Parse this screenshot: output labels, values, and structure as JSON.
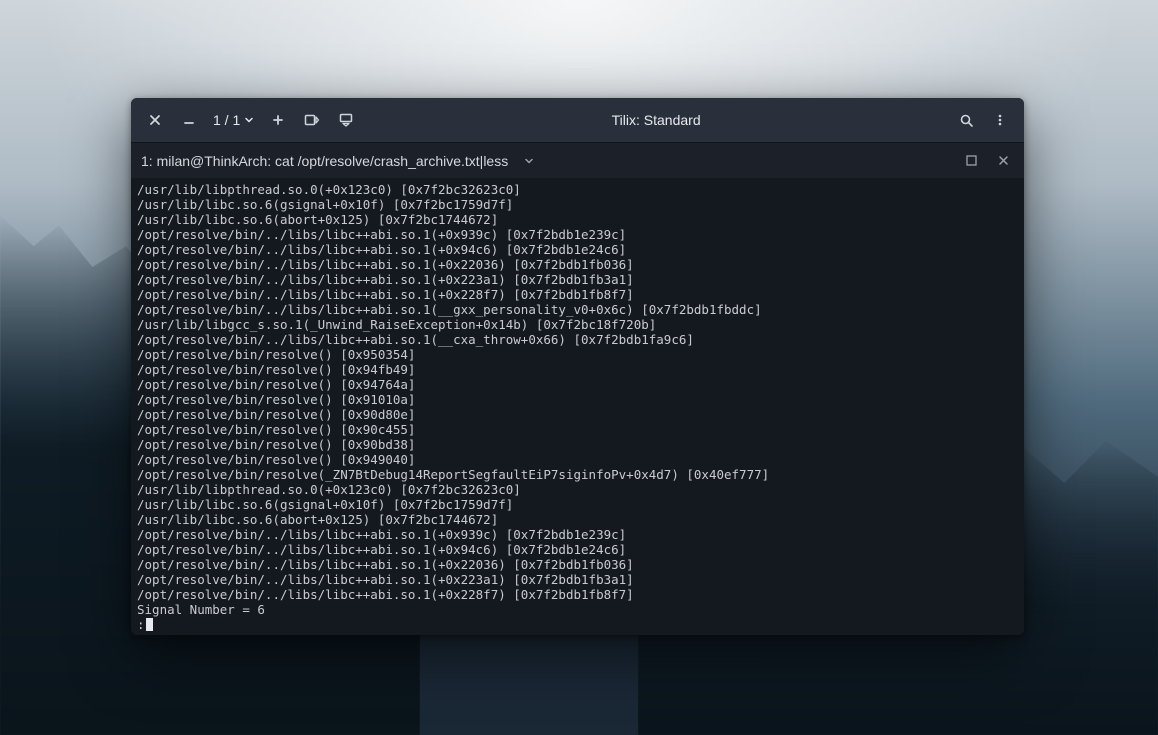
{
  "window": {
    "title": "Tilix: Standard",
    "session_counter": "1 / 1"
  },
  "tab": {
    "title": "1: milan@ThinkArch: cat /opt/resolve/crash_archive.txt|less"
  },
  "terminal": {
    "lines": [
      "/usr/lib/libpthread.so.0(+0x123c0) [0x7f2bc32623c0]",
      "/usr/lib/libc.so.6(gsignal+0x10f) [0x7f2bc1759d7f]",
      "/usr/lib/libc.so.6(abort+0x125) [0x7f2bc1744672]",
      "/opt/resolve/bin/../libs/libc++abi.so.1(+0x939c) [0x7f2bdb1e239c]",
      "/opt/resolve/bin/../libs/libc++abi.so.1(+0x94c6) [0x7f2bdb1e24c6]",
      "/opt/resolve/bin/../libs/libc++abi.so.1(+0x22036) [0x7f2bdb1fb036]",
      "/opt/resolve/bin/../libs/libc++abi.so.1(+0x223a1) [0x7f2bdb1fb3a1]",
      "/opt/resolve/bin/../libs/libc++abi.so.1(+0x228f7) [0x7f2bdb1fb8f7]",
      "/opt/resolve/bin/../libs/libc++abi.so.1(__gxx_personality_v0+0x6c) [0x7f2bdb1fbddc]",
      "/usr/lib/libgcc_s.so.1(_Unwind_RaiseException+0x14b) [0x7f2bc18f720b]",
      "/opt/resolve/bin/../libs/libc++abi.so.1(__cxa_throw+0x66) [0x7f2bdb1fa9c6]",
      "/opt/resolve/bin/resolve() [0x950354]",
      "/opt/resolve/bin/resolve() [0x94fb49]",
      "/opt/resolve/bin/resolve() [0x94764a]",
      "/opt/resolve/bin/resolve() [0x91010a]",
      "/opt/resolve/bin/resolve() [0x90d80e]",
      "/opt/resolve/bin/resolve() [0x90c455]",
      "/opt/resolve/bin/resolve() [0x90bd38]",
      "/opt/resolve/bin/resolve() [0x949040]",
      "/opt/resolve/bin/resolve(_ZN7BtDebug14ReportSegfaultEiP7siginfoPv+0x4d7) [0x40ef777]",
      "/usr/lib/libpthread.so.0(+0x123c0) [0x7f2bc32623c0]",
      "/usr/lib/libc.so.6(gsignal+0x10f) [0x7f2bc1759d7f]",
      "/usr/lib/libc.so.6(abort+0x125) [0x7f2bc1744672]",
      "/opt/resolve/bin/../libs/libc++abi.so.1(+0x939c) [0x7f2bdb1e239c]",
      "/opt/resolve/bin/../libs/libc++abi.so.1(+0x94c6) [0x7f2bdb1e24c6]",
      "/opt/resolve/bin/../libs/libc++abi.so.1(+0x22036) [0x7f2bdb1fb036]",
      "/opt/resolve/bin/../libs/libc++abi.so.1(+0x223a1) [0x7f2bdb1fb3a1]",
      "/opt/resolve/bin/../libs/libc++abi.so.1(+0x228f7) [0x7f2bdb1fb8f7]",
      "Signal Number = 6"
    ],
    "prompt": ":"
  }
}
